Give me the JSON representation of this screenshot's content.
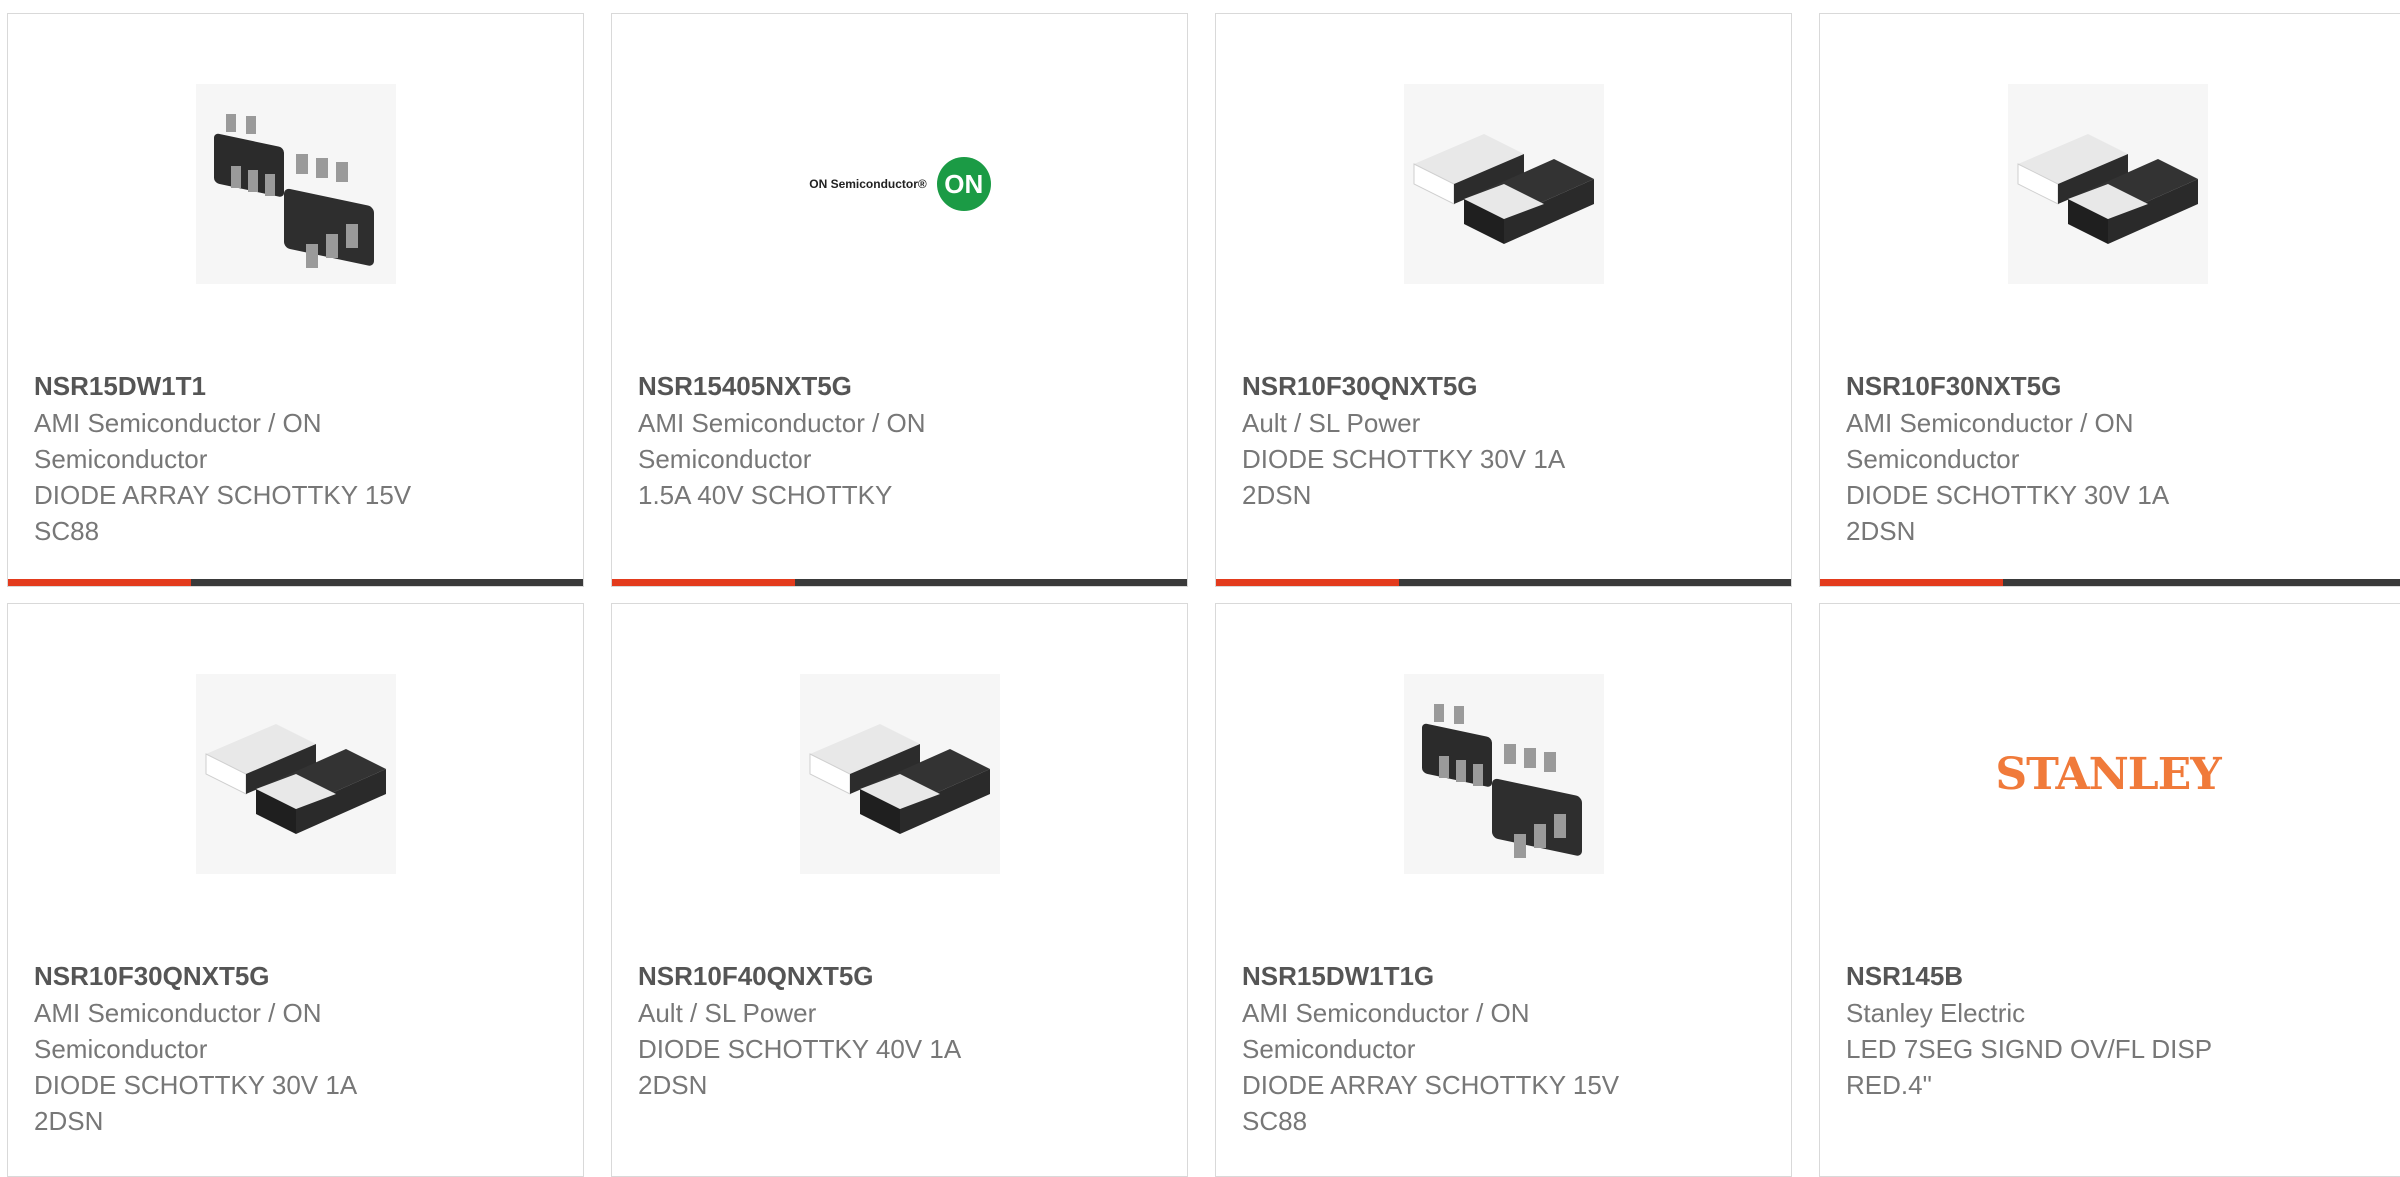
{
  "colors": {
    "accent": "#e33b1d",
    "bar": "#3a3a3a",
    "border": "#d9d9d9",
    "title": "#555555",
    "text": "#777777"
  },
  "cards": [
    {
      "part": "NSR15DW1T1",
      "image": "sc88-package-icon",
      "lines": [
        "AMI Semiconductor / ON",
        "Semiconductor",
        "DIODE ARRAY SCHOTTKY 15V",
        "SC88"
      ]
    },
    {
      "part": "NSR15405NXT5G",
      "image": "on-semiconductor-logo",
      "logo_text": "ON Semiconductor®",
      "logo_badge": "ON",
      "lines": [
        "AMI Semiconductor / ON",
        "Semiconductor",
        "1.5A 40V SCHOTTKY"
      ]
    },
    {
      "part": "NSR10F30QNXT5G",
      "image": "dsn2-package-icon",
      "lines": [
        "Ault / SL Power",
        "DIODE SCHOTTKY 30V 1A",
        "2DSN"
      ]
    },
    {
      "part": "NSR10F30NXT5G",
      "image": "dsn2-package-icon",
      "lines": [
        "AMI Semiconductor / ON",
        "Semiconductor",
        "DIODE SCHOTTKY 30V 1A",
        "2DSN"
      ]
    },
    {
      "part": "NSR10F30QNXT5G",
      "image": "dsn2-package-icon",
      "lines": [
        "AMI Semiconductor / ON",
        "Semiconductor",
        "DIODE SCHOTTKY 30V 1A",
        "2DSN"
      ]
    },
    {
      "part": "NSR10F40QNXT5G",
      "image": "dsn2-package-icon",
      "lines": [
        "Ault / SL Power",
        "DIODE SCHOTTKY 40V 1A",
        "2DSN"
      ]
    },
    {
      "part": "NSR15DW1T1G",
      "image": "sc88-package-icon",
      "lines": [
        "AMI Semiconductor / ON",
        "Semiconductor",
        "DIODE ARRAY SCHOTTKY 15V",
        "SC88"
      ]
    },
    {
      "part": "NSR145B",
      "image": "stanley-logo",
      "logo_text": "STANLEY",
      "lines": [
        "Stanley Electric",
        "LED 7SEG SIGND OV/FL DISP",
        "RED.4\""
      ]
    }
  ]
}
